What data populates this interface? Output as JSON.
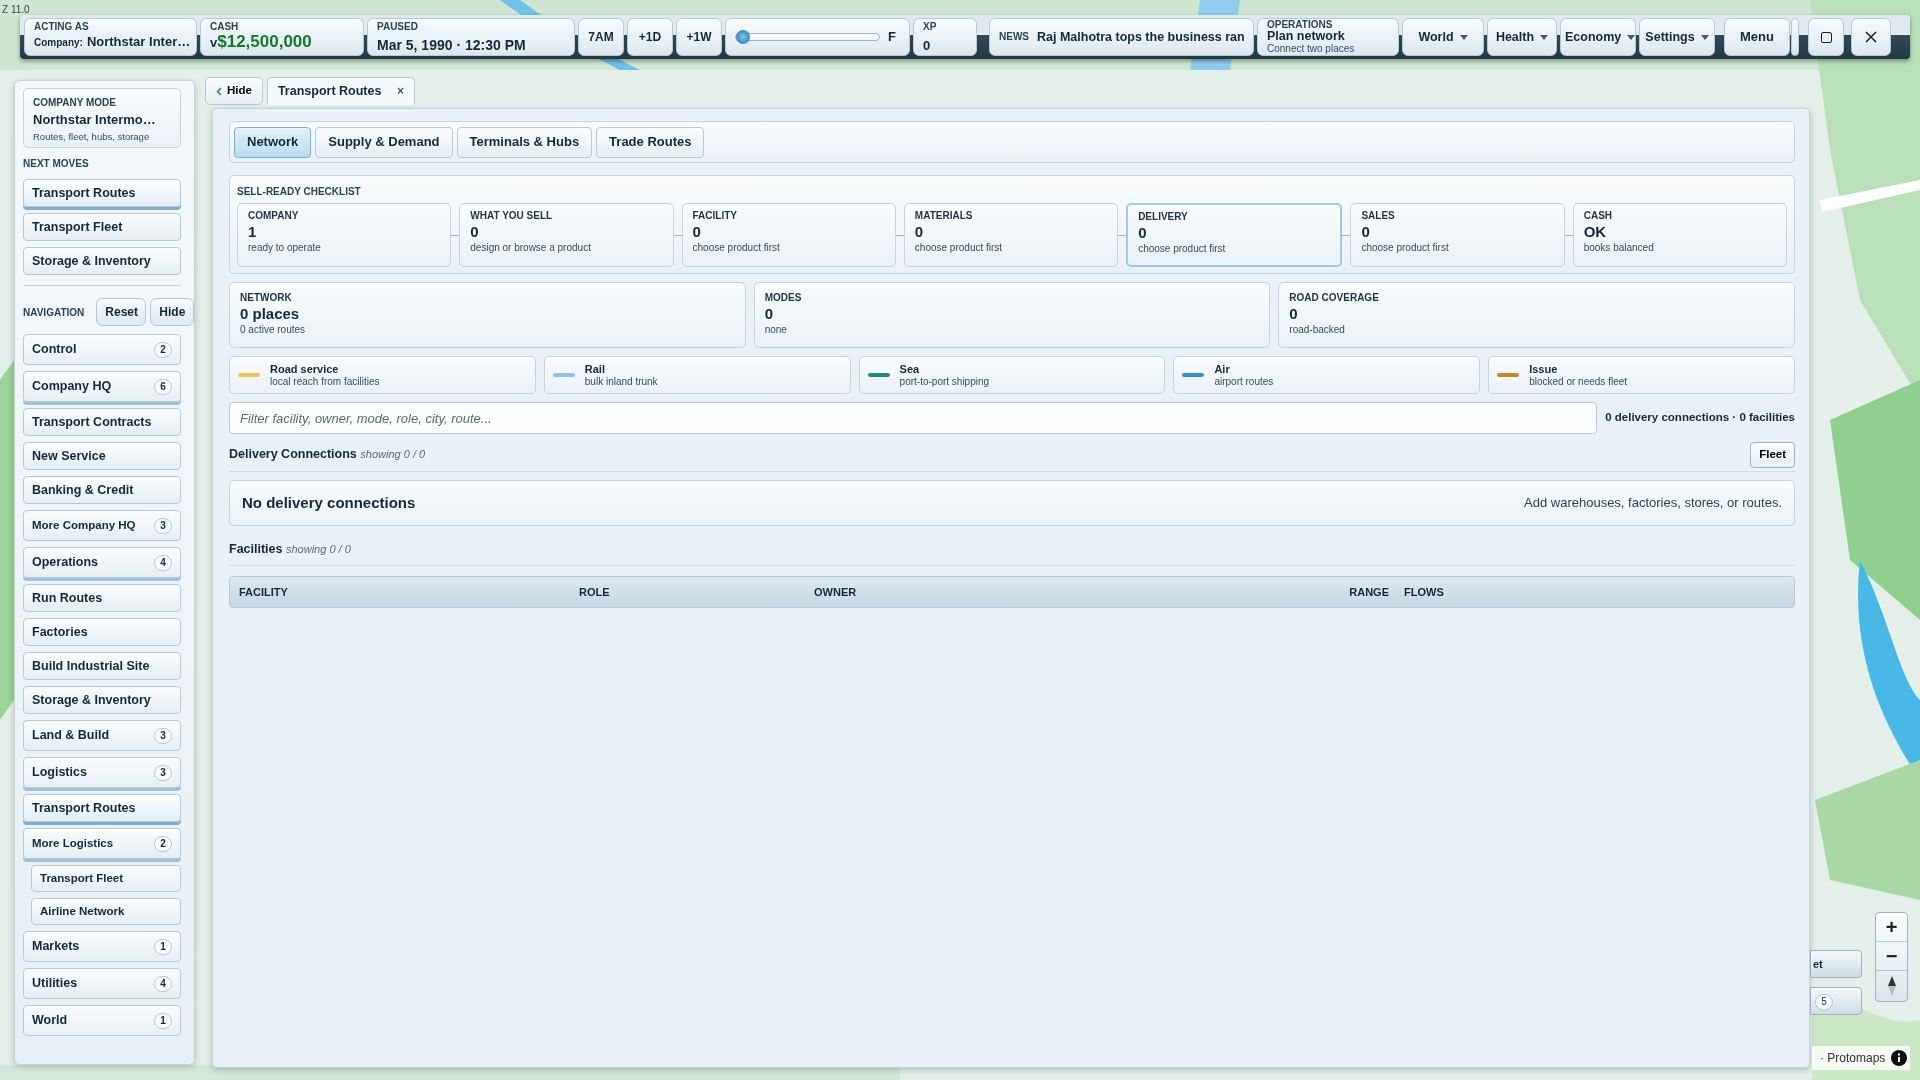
{
  "zoom_label": "Z 11.0",
  "top_bar": {
    "acting_as": {
      "label": "ACTING AS",
      "prefix": "Company:",
      "value": "Northstar Inter…"
    },
    "cash": {
      "label": "CASH",
      "prefix": "v",
      "value": "$12,500,000"
    },
    "clock": {
      "label": "PAUSED",
      "value": "Mar 5, 1990 · 12:30 PM"
    },
    "time_buttons": [
      "7AM",
      "+1D",
      "+1W"
    ],
    "speed": {
      "level": 0.0,
      "label": "F"
    },
    "xp": {
      "label": "XP",
      "value": "0"
    },
    "news": {
      "label": "NEWS",
      "headline": "Raj Malhotra tops the business ran"
    },
    "operations": {
      "label": "OPERATIONS",
      "title": "Plan network",
      "note": "Connect two places"
    },
    "menus": [
      "World",
      "Health",
      "Economy",
      "Settings"
    ],
    "menu_button": "Menu"
  },
  "sidebar": {
    "mode": {
      "label": "COMPANY MODE",
      "name": "Northstar Intermo…",
      "note": "Routes, fleet, hubs, storage"
    },
    "next_moves_label": "NEXT MOVES",
    "next_moves": [
      {
        "label": "Transport Routes",
        "selected": true
      },
      {
        "label": "Transport Fleet",
        "selected": false
      },
      {
        "label": "Storage & Inventory",
        "selected": false
      }
    ],
    "navigation_label": "NAVIGATION",
    "reset": "Reset",
    "hide": "Hide",
    "items": [
      {
        "label": "Control",
        "count": "2",
        "kind": "group",
        "expanded": false,
        "selected": false
      },
      {
        "label": "Company HQ",
        "count": "6",
        "kind": "group",
        "expanded": true,
        "selected": false
      },
      {
        "label": "Transport Contracts",
        "kind": "link",
        "selected": false
      },
      {
        "label": "New Service",
        "kind": "link",
        "selected": false
      },
      {
        "label": "Banking & Credit",
        "kind": "link",
        "selected": false
      },
      {
        "label": "More Company HQ",
        "count": "3",
        "kind": "subgroup",
        "expanded": false,
        "selected": false
      },
      {
        "label": "Operations",
        "count": "4",
        "kind": "group",
        "expanded": true,
        "selected": false
      },
      {
        "label": "Run Routes",
        "kind": "link",
        "selected": false
      },
      {
        "label": "Factories",
        "kind": "link",
        "selected": false
      },
      {
        "label": "Build Industrial Site",
        "kind": "link",
        "selected": false
      },
      {
        "label": "Storage & Inventory",
        "kind": "link",
        "selected": false
      },
      {
        "label": "Land & Build",
        "count": "3",
        "kind": "group",
        "expanded": false,
        "selected": false
      },
      {
        "label": "Logistics",
        "count": "3",
        "kind": "group",
        "expanded": true,
        "selected": false
      },
      {
        "label": "Transport Routes",
        "kind": "link",
        "selected": true
      },
      {
        "label": "More Logistics",
        "count": "2",
        "kind": "subgroup",
        "expanded": true,
        "selected": false,
        "children": [
          {
            "label": "Transport Fleet",
            "selected": false
          },
          {
            "label": "Airline Network",
            "selected": false
          }
        ]
      },
      {
        "label": "Markets",
        "count": "1",
        "kind": "group",
        "expanded": false,
        "selected": false
      },
      {
        "label": "Utilities",
        "count": "4",
        "kind": "group",
        "expanded": false,
        "selected": false
      },
      {
        "label": "World",
        "count": "1",
        "kind": "group",
        "expanded": false,
        "selected": false
      }
    ]
  },
  "panel_tabs": {
    "hide": "Hide",
    "tabs": [
      {
        "label": "Transport Routes",
        "close": "×",
        "selected": true
      }
    ]
  },
  "sub_tabs": [
    {
      "label": "Network",
      "selected": true
    },
    {
      "label": "Supply & Demand",
      "selected": false
    },
    {
      "label": "Terminals & Hubs",
      "selected": false
    },
    {
      "label": "Trade Routes",
      "selected": false
    }
  ],
  "checklist": {
    "title": "SELL-READY CHECKLIST",
    "steps": [
      {
        "label": "COMPANY",
        "value": "1",
        "note": "ready to operate",
        "current": false
      },
      {
        "label": "WHAT YOU SELL",
        "value": "0",
        "note": "design or browse a product",
        "current": false
      },
      {
        "label": "FACILITY",
        "value": "0",
        "note": "choose product first",
        "current": false
      },
      {
        "label": "MATERIALS",
        "value": "0",
        "note": "choose product first",
        "current": false
      },
      {
        "label": "DELIVERY",
        "value": "0",
        "note": "choose product first",
        "current": true
      },
      {
        "label": "SALES",
        "value": "0",
        "note": "choose product first",
        "current": false
      },
      {
        "label": "CASH",
        "value": "OK",
        "note": "books balanced",
        "current": false
      }
    ]
  },
  "stats": [
    {
      "label": "NETWORK",
      "value": "0 places",
      "note": "0 active routes"
    },
    {
      "label": "MODES",
      "value": "0",
      "note": "none"
    },
    {
      "label": "ROAD COVERAGE",
      "value": "0",
      "note": "road-backed"
    }
  ],
  "legend": [
    {
      "label": "Road service",
      "note": "local reach from facilities",
      "color": "#f2c14e"
    },
    {
      "label": "Rail",
      "note": "bulk inland trunk",
      "color": "#8ec5f0"
    },
    {
      "label": "Sea",
      "note": "port-to-port shipping",
      "color": "#1a8f80"
    },
    {
      "label": "Air",
      "note": "airport routes",
      "color": "#2f8fd8"
    },
    {
      "label": "Issue",
      "note": "blocked or needs fleet",
      "color": "#c88a1e"
    }
  ],
  "filter": {
    "placeholder": "Filter facility, owner, mode, role, city, route...",
    "summary": "0 delivery connections · 0 facilities"
  },
  "delivery": {
    "title": "Delivery Connections",
    "note": "showing 0 / 0",
    "button": "Fleet",
    "empty_title": "No delivery connections",
    "empty_hint": "Add warehouses, factories, stores, or routes."
  },
  "facilities": {
    "title": "Facilities",
    "note": "showing 0 / 0",
    "columns": [
      "FACILITY",
      "ROLE",
      "OWNER",
      "RANGE",
      "FLOWS"
    ]
  },
  "map_controls": {
    "zoom_in": "+",
    "zoom_out": "−",
    "partial_button": "et",
    "partial_badge": "5",
    "attribution": "· Protomaps"
  }
}
